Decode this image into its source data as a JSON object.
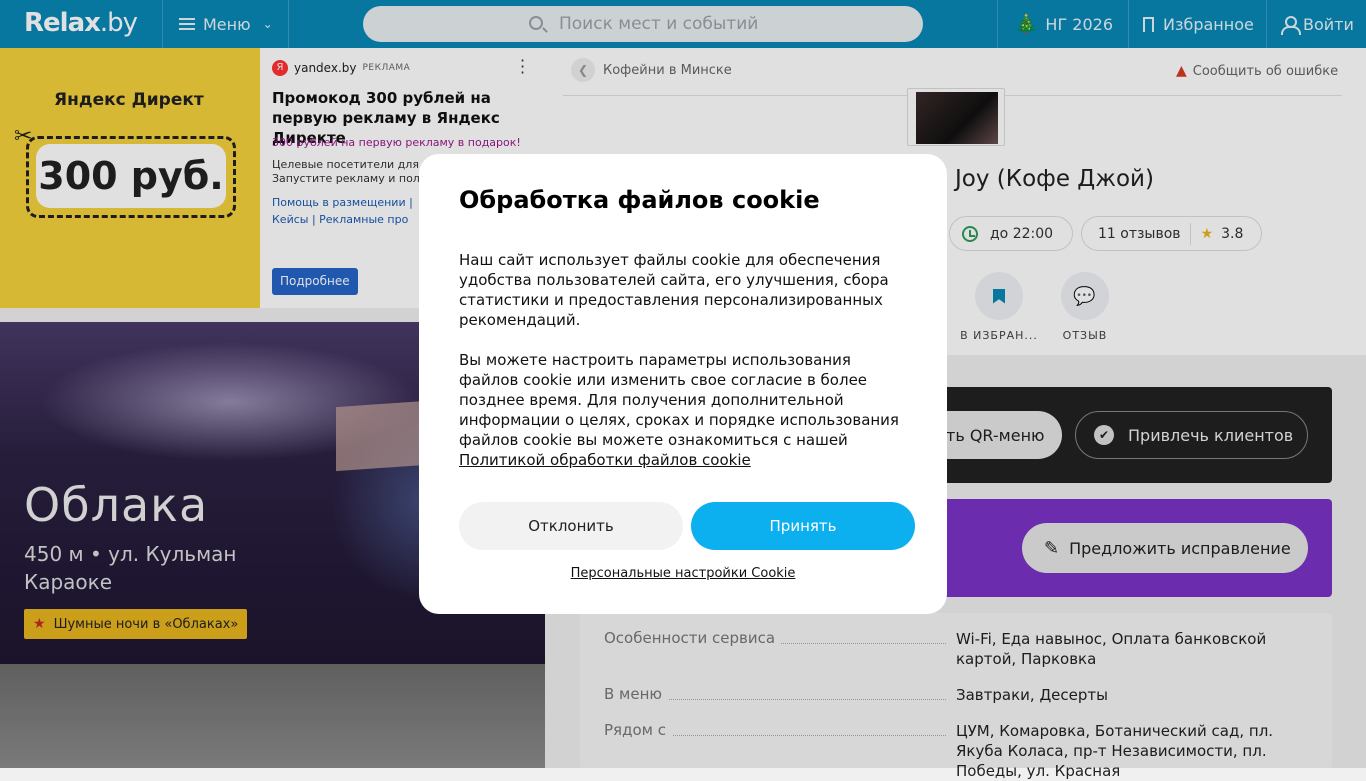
{
  "header": {
    "logo": "Relax",
    "logo_suffix": ".by",
    "menu_label": "Меню",
    "search_placeholder": "Поиск мест и событий",
    "ng_label": "НГ 2026",
    "favorites_label": "Избранное",
    "login_label": "Войти"
  },
  "ad": {
    "brand": "Яндекс Директ",
    "price": "300 руб.",
    "source": "yandex.by",
    "source_label": "РЕКЛАМА",
    "title": "Промокод 300 рублей на первую рекламу в Яндекс Директе",
    "subtitle": "300 рублей на первую рекламу в подарок!",
    "desc_line1": "Целевые посетители для ли",
    "desc_line2": "Запустите рекламу и полу",
    "link_line1": "Помощь в размещении  |",
    "link_line2": "Кейсы  |  Рекламные про",
    "more_button": "Подробнее"
  },
  "promo": {
    "title": "Облака",
    "distance_address": "450 м • ул. Кульман",
    "category": "Караоке",
    "tag": "Шумные ночи в «Облаках»"
  },
  "place": {
    "breadcrumb": "Кофейни в Минске",
    "report_error": "Сообщить об ошибке",
    "name": "Joy (Кофе Джой)",
    "hours": "до 22:00",
    "reviews": "11 отзывов",
    "rating": "3.8",
    "action_favorite": "В ИЗБРАН...",
    "action_review": "ОТЗЫВ",
    "qr_menu_button": "ть QR-меню",
    "attract_clients_button": "Привлечь клиентов",
    "suggest_fix_button": "Предложить исправление",
    "info": [
      {
        "key": "Особенности сервиса",
        "value": "Wi-Fi, Еда навынос, Оплата банковской картой, Парковка"
      },
      {
        "key": "В меню",
        "value": "Завтраки, Десерты"
      },
      {
        "key": "Рядом с",
        "value": "ЦУМ, Комаровка, Ботанический сад, пл. Якуба Коласа, пр-т Независимости, пл. Победы, ул. Красная"
      }
    ]
  },
  "cookie_modal": {
    "title": "Обработка файлов cookie",
    "paragraph1": "Наш сайт использует файлы cookie для обеспечения удобства пользователей сайта, его улучшения, сбора статистики и предоставления персонализированных рекомендаций.",
    "paragraph2": "Вы можете настроить параметры использования файлов cookie или изменить свое согласие в более позднее время. Для получения дополнительной информации о целях, сроках и порядке использования файлов cookie вы можете ознакомиться с нашей",
    "policy_link": "Политикой обработки файлов cookie",
    "decline_button": "Отклонить",
    "accept_button": "Принять",
    "personal_settings_link": "Персональные настройки Cookie"
  }
}
